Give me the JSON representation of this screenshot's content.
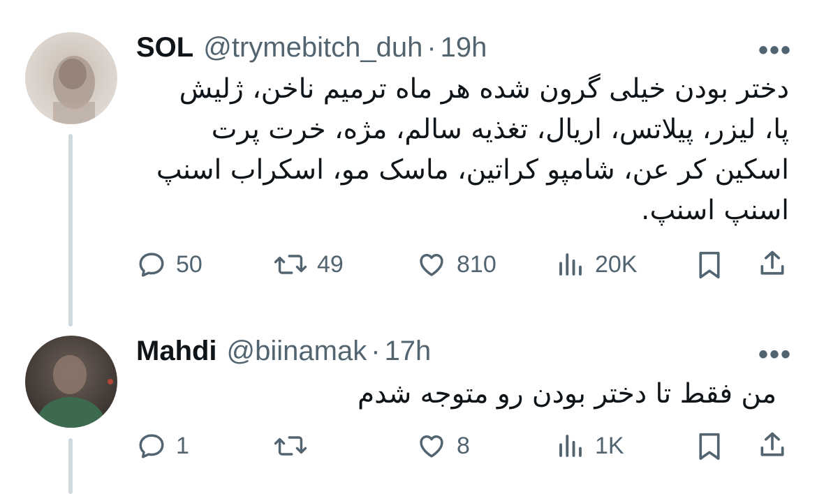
{
  "tweets": [
    {
      "display_name": "SOL",
      "handle": "@trymebitch_duh",
      "separator": "·",
      "time": "19h",
      "more_label": "•••",
      "text_lines": [
        "دختر بودن خیلی گرون شده هر ماه ترمیم ناخن، ژلیش",
        "پا، لیزر، پیلاتس، اریال، تغذیه سالم، مژه، خرت پرت",
        "اسکین کر عن، شامپو کراتین، ماسک مو، اسکراب اسنپ",
        "اسنپ اسنپ."
      ],
      "replies": "50",
      "retweets": "49",
      "likes": "810",
      "views": "20K"
    },
    {
      "display_name": "Mahdi",
      "handle": "@biinamak",
      "separator": "·",
      "time": "17h",
      "more_label": "•••",
      "text_lines": [
        "من فقط تا دختر بودن رو متوجه شدم"
      ],
      "replies": "1",
      "retweets": "",
      "likes": "8",
      "views": "1K"
    }
  ],
  "icons": {
    "reply": "reply-icon",
    "retweet": "retweet-icon",
    "like": "heart-icon",
    "views": "views-icon",
    "bookmark": "bookmark-icon",
    "share": "share-icon"
  },
  "colors": {
    "text": "#0f1419",
    "secondary": "#536471",
    "thread_line": "#cfd9de"
  }
}
